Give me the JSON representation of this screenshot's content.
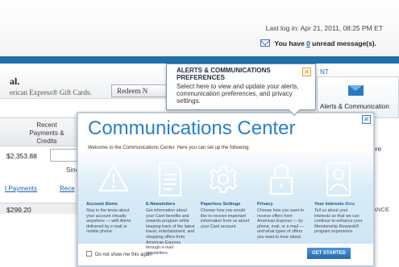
{
  "header": {
    "last_login": "Last log in: Apr 21, 2011, 08:25 PM ET",
    "unread_prefix": "You have ",
    "unread_count": "0",
    "unread_suffix": " unread message(s)."
  },
  "promo": {
    "title": "al.",
    "subtitle": "erican Express® Gift Cards.",
    "redeem_button": "Redeem N"
  },
  "right_column": {
    "nt_label": "NT",
    "alerts_label": "Alerts & Communication",
    "alerts_label_2": "es",
    "here_text": "here",
    "balance_text": "LANCE"
  },
  "table": {
    "recent_header": "Recent Payments & Credits",
    "amount_1": "$2,353.88",
    "since_text": "Sinc",
    "payments_link": "t Payments",
    "recent_link": "Rece",
    "amount_2": "$299.20"
  },
  "tooltip": {
    "title": "ALERTS & COMMUNICATIONS PREFERENCES",
    "body": "Select here to view and update your alerts, communication preferences, and privacy settings.",
    "close_glyph": "✕"
  },
  "modal": {
    "title": "Communications Center",
    "welcome": "Welcome to the Communications Center. Here you can set up the following:",
    "close_glyph": "✕",
    "features": [
      {
        "icon": "alert-icon",
        "title": "Account Alerts",
        "desc": "Stay in the know about your account virtually anywhere — with Alerts delivered by e-mail or mobile phone."
      },
      {
        "icon": "document-icon",
        "title": "E-Newsletters",
        "desc": "Get information about your Card benefits and rewards program while keeping track of the latest travel, entertainment, and shopping offers from American Express through e-mail newsletters."
      },
      {
        "icon": "gear-icon",
        "title": "Paperless Settings",
        "desc": "Choose how you would like to receive important information from us about your Card account."
      },
      {
        "icon": "lock-icon",
        "title": "Privacy",
        "desc": "Choose how you want to receive offers from American Express — by phone, mail, or e-mail — and what types of offers you want to hear about."
      },
      {
        "icon": "profile-icon",
        "title": "Your Interests",
        "title_badge": "Beta",
        "desc": "Tell us about your interests so that we can continue to enhance your Membership Rewards® program experience."
      }
    ],
    "dont_show": "Do not show me this again",
    "get_started": "GET STARTED"
  },
  "colors": {
    "brand_blue": "#2a7fc7",
    "band_blue": "#1f6fa8",
    "button_blue": "#2268b2"
  }
}
